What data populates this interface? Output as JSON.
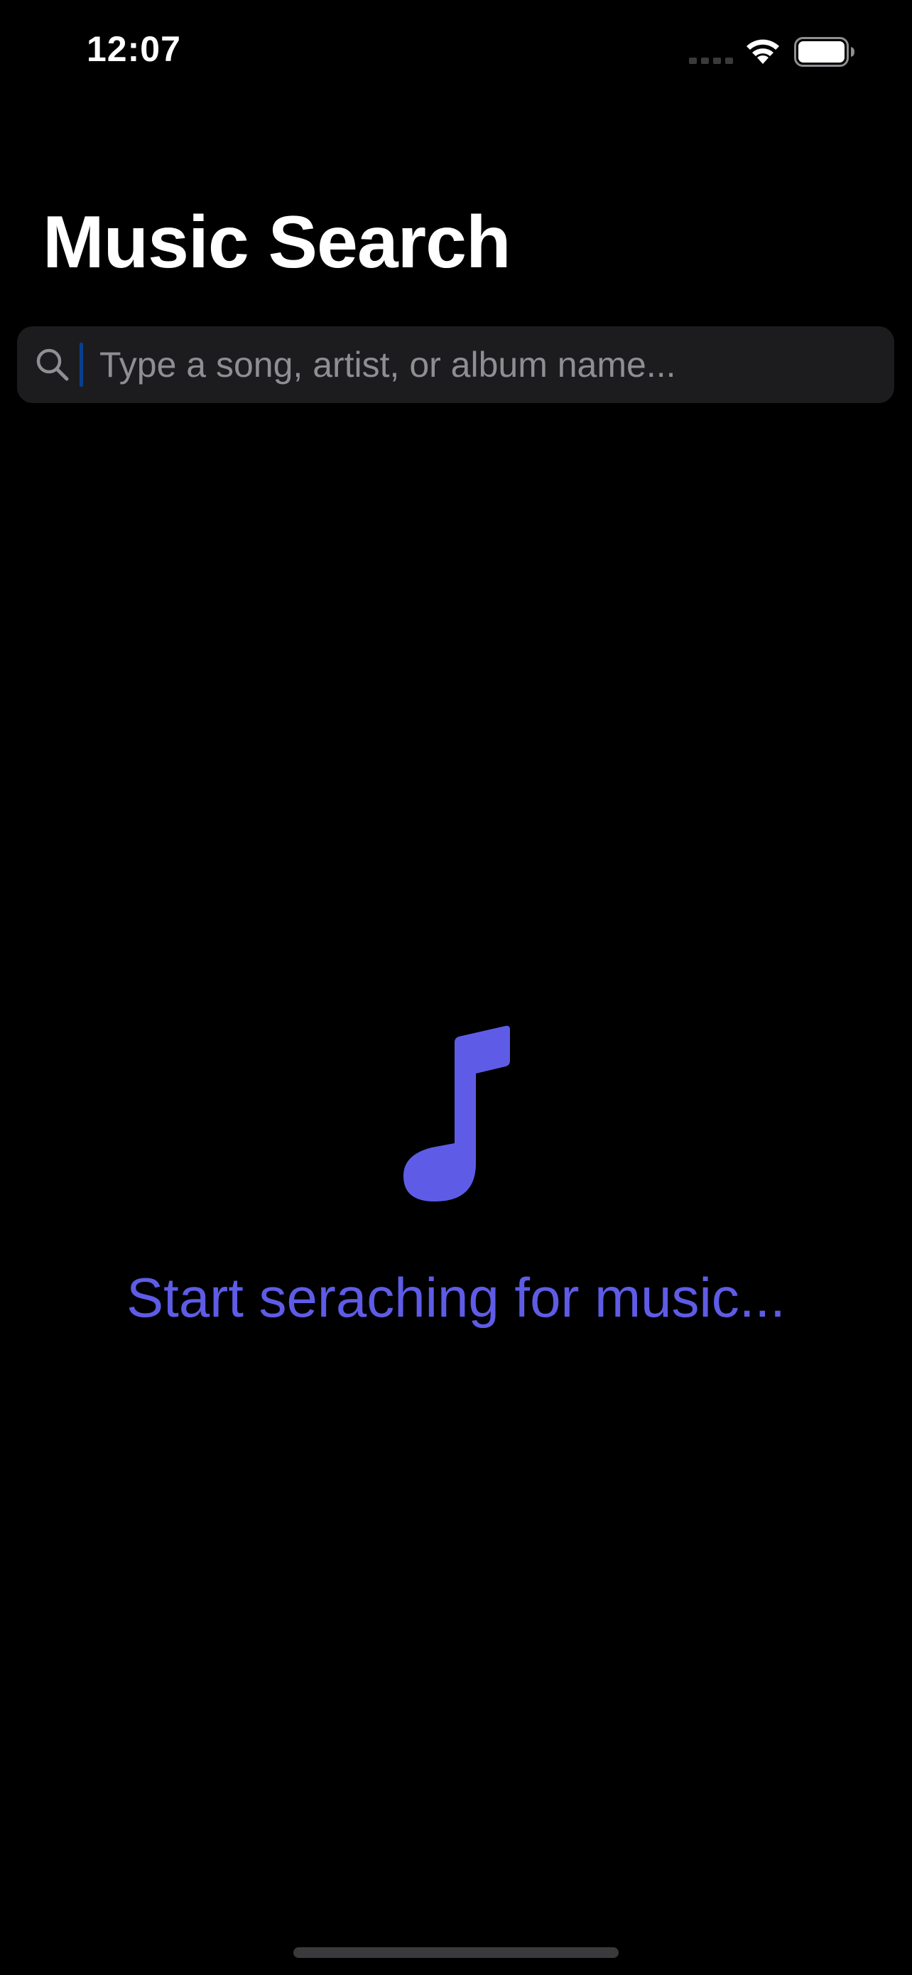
{
  "status_bar": {
    "time": "12:07",
    "icons": [
      "cellular-signal-icon",
      "wifi-icon",
      "battery-icon"
    ]
  },
  "header": {
    "title": "Music Search"
  },
  "search": {
    "placeholder": "Type a song, artist, or album name...",
    "value": "",
    "icon": "search-icon"
  },
  "empty_state": {
    "icon": "music-note-icon",
    "message": "Start seraching for music..."
  },
  "colors": {
    "background": "#000000",
    "accent": "#5E5CE6",
    "search_field": "#1C1C1E",
    "placeholder": "#8E8E93",
    "caret": "#0A3F8F"
  }
}
